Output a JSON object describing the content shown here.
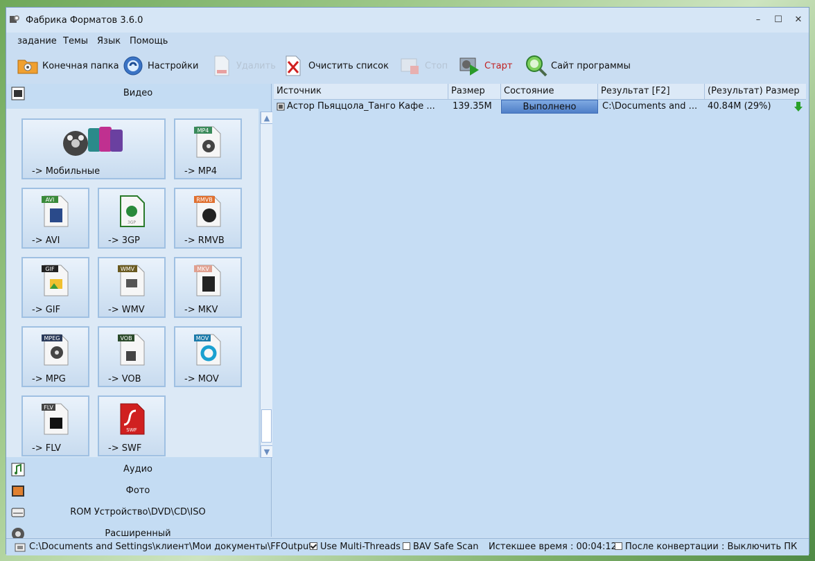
{
  "window": {
    "title": "Фабрика Форматов 3.6.0",
    "minimize": "–",
    "maximize": "☐",
    "close": "✕"
  },
  "menu": [
    "задание",
    "Темы",
    "Язык",
    "Помощь"
  ],
  "toolbar": {
    "output_folder": "Конечная папка",
    "settings": "Настройки",
    "remove": "Удалить",
    "clear_list": "Очистить список",
    "stop": "Стоп",
    "start": "Старт",
    "website": "Сайт программы"
  },
  "categories": {
    "video": "Видео",
    "audio": "Аудио",
    "photo": "Фото",
    "rom": "ROM Устройство\\DVD\\CD\\ISO",
    "advanced": "Расширенный"
  },
  "video_tiles": [
    {
      "label": "-> Мобильные",
      "badge": ""
    },
    {
      "label": "-> MP4",
      "badge": "MP4"
    },
    {
      "label": "-> AVI",
      "badge": "AVI"
    },
    {
      "label": "-> 3GP",
      "badge": "3GP"
    },
    {
      "label": "-> RMVB",
      "badge": "RMVB"
    },
    {
      "label": "-> GIF",
      "badge": "GIF"
    },
    {
      "label": "-> WMV",
      "badge": "WMV"
    },
    {
      "label": "-> MKV",
      "badge": "MKV"
    },
    {
      "label": "-> MPG",
      "badge": "MPEG"
    },
    {
      "label": "-> VOB",
      "badge": "VOB"
    },
    {
      "label": "-> MOV",
      "badge": "MOV"
    },
    {
      "label": "-> FLV",
      "badge": "FLV"
    },
    {
      "label": "-> SWF",
      "badge": "SWF"
    }
  ],
  "table": {
    "headers": [
      "Источник",
      "Размер",
      "Состояние",
      "Результат [F2]",
      "(Результат) Размер"
    ],
    "rows": [
      {
        "source": "Астор Пьяццола_Танго Кафе ...",
        "size": "139.35M",
        "status": "Выполнено",
        "result": "C:\\Documents and ...",
        "result_size": "40.84M  (29%)"
      }
    ]
  },
  "statusbar": {
    "path": "C:\\Documents and Settings\\клиент\\Мои документы\\FFOutput",
    "multithreads": "Use Multi-Threads",
    "multithreads_checked": true,
    "bav": "BAV Safe Scan",
    "bav_checked": false,
    "elapsed": "Истекшее время : 00:04:12",
    "after": "После конвертации : Выключить ПК",
    "after_checked": false
  },
  "colors": {
    "window_bg": "#c9ddf2",
    "status_done": "#4f7fc8",
    "start_text": "#c02020"
  }
}
